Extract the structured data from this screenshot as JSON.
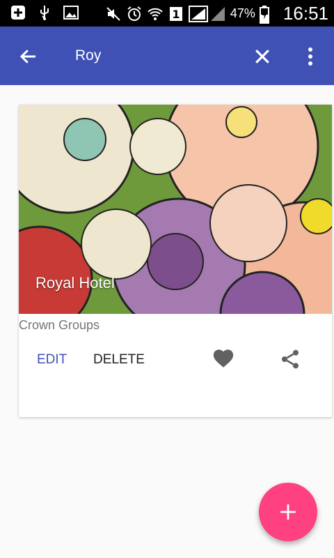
{
  "statusbar": {
    "icons": [
      "add-box-icon",
      "usb-icon",
      "image-icon",
      "mute-icon",
      "alarm-icon",
      "wifi-icon",
      "sim-1-icon",
      "signal-icon",
      "signal-empty-icon",
      "battery-icon"
    ],
    "battery_percent": "47%",
    "time": "16:51"
  },
  "appbar": {
    "title": "Roy",
    "color": "#3f51b5"
  },
  "card": {
    "image_caption": "Royal Hotel",
    "subtitle": "Crown Groups",
    "edit_label": "EDIT",
    "delete_label": "DELETE",
    "accent": "#3f51b5"
  },
  "fab": {
    "color": "#ff4081",
    "icon": "plus-icon"
  }
}
